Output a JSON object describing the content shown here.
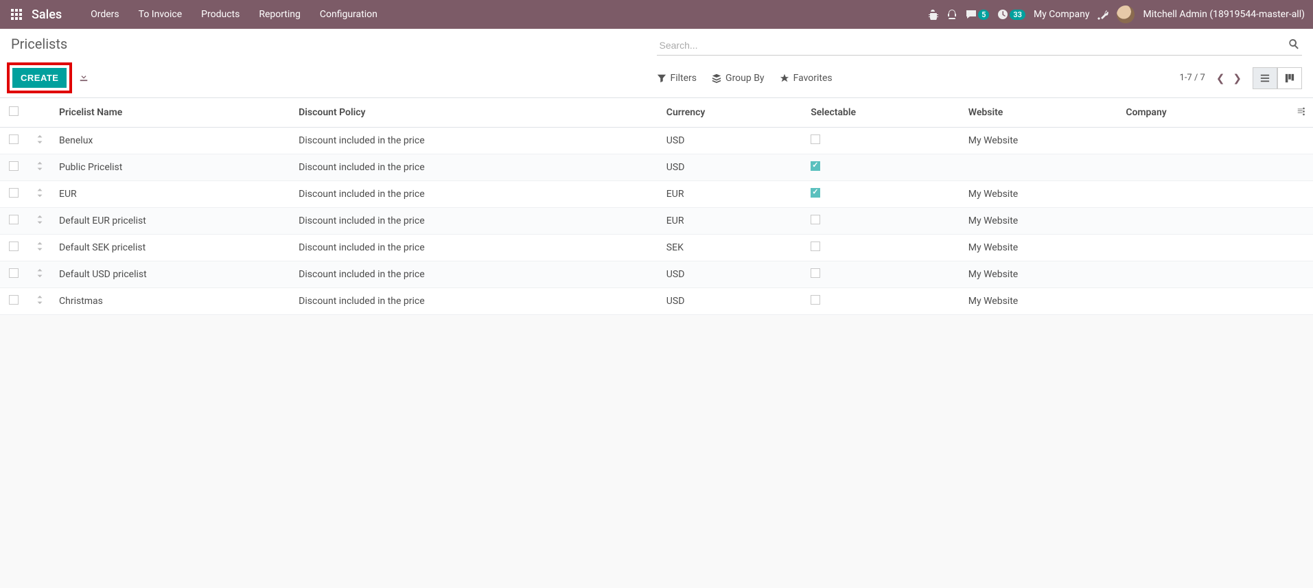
{
  "navbar": {
    "app_name": "Sales",
    "menu": [
      "Orders",
      "To Invoice",
      "Products",
      "Reporting",
      "Configuration"
    ],
    "messages_badge": "5",
    "activities_badge": "33",
    "company": "My Company",
    "user": "Mitchell Admin (18919544-master-all)"
  },
  "control_panel": {
    "title": "Pricelists",
    "search_placeholder": "Search...",
    "create_label": "CREATE",
    "filters_label": "Filters",
    "groupby_label": "Group By",
    "favorites_label": "Favorites",
    "pager": "1-7 / 7"
  },
  "table": {
    "headers": {
      "name": "Pricelist Name",
      "discount": "Discount Policy",
      "currency": "Currency",
      "selectable": "Selectable",
      "website": "Website",
      "company": "Company"
    },
    "rows": [
      {
        "name": "Benelux",
        "discount": "Discount included in the price",
        "currency": "USD",
        "selectable": false,
        "website": "My Website",
        "company": ""
      },
      {
        "name": "Public Pricelist",
        "discount": "Discount included in the price",
        "currency": "USD",
        "selectable": true,
        "website": "",
        "company": ""
      },
      {
        "name": "EUR",
        "discount": "Discount included in the price",
        "currency": "EUR",
        "selectable": true,
        "website": "My Website",
        "company": ""
      },
      {
        "name": "Default EUR pricelist",
        "discount": "Discount included in the price",
        "currency": "EUR",
        "selectable": false,
        "website": "My Website",
        "company": ""
      },
      {
        "name": "Default SEK pricelist",
        "discount": "Discount included in the price",
        "currency": "SEK",
        "selectable": false,
        "website": "My Website",
        "company": ""
      },
      {
        "name": "Default USD pricelist",
        "discount": "Discount included in the price",
        "currency": "USD",
        "selectable": false,
        "website": "My Website",
        "company": ""
      },
      {
        "name": "Christmas",
        "discount": "Discount included in the price",
        "currency": "USD",
        "selectable": false,
        "website": "My Website",
        "company": ""
      }
    ]
  }
}
